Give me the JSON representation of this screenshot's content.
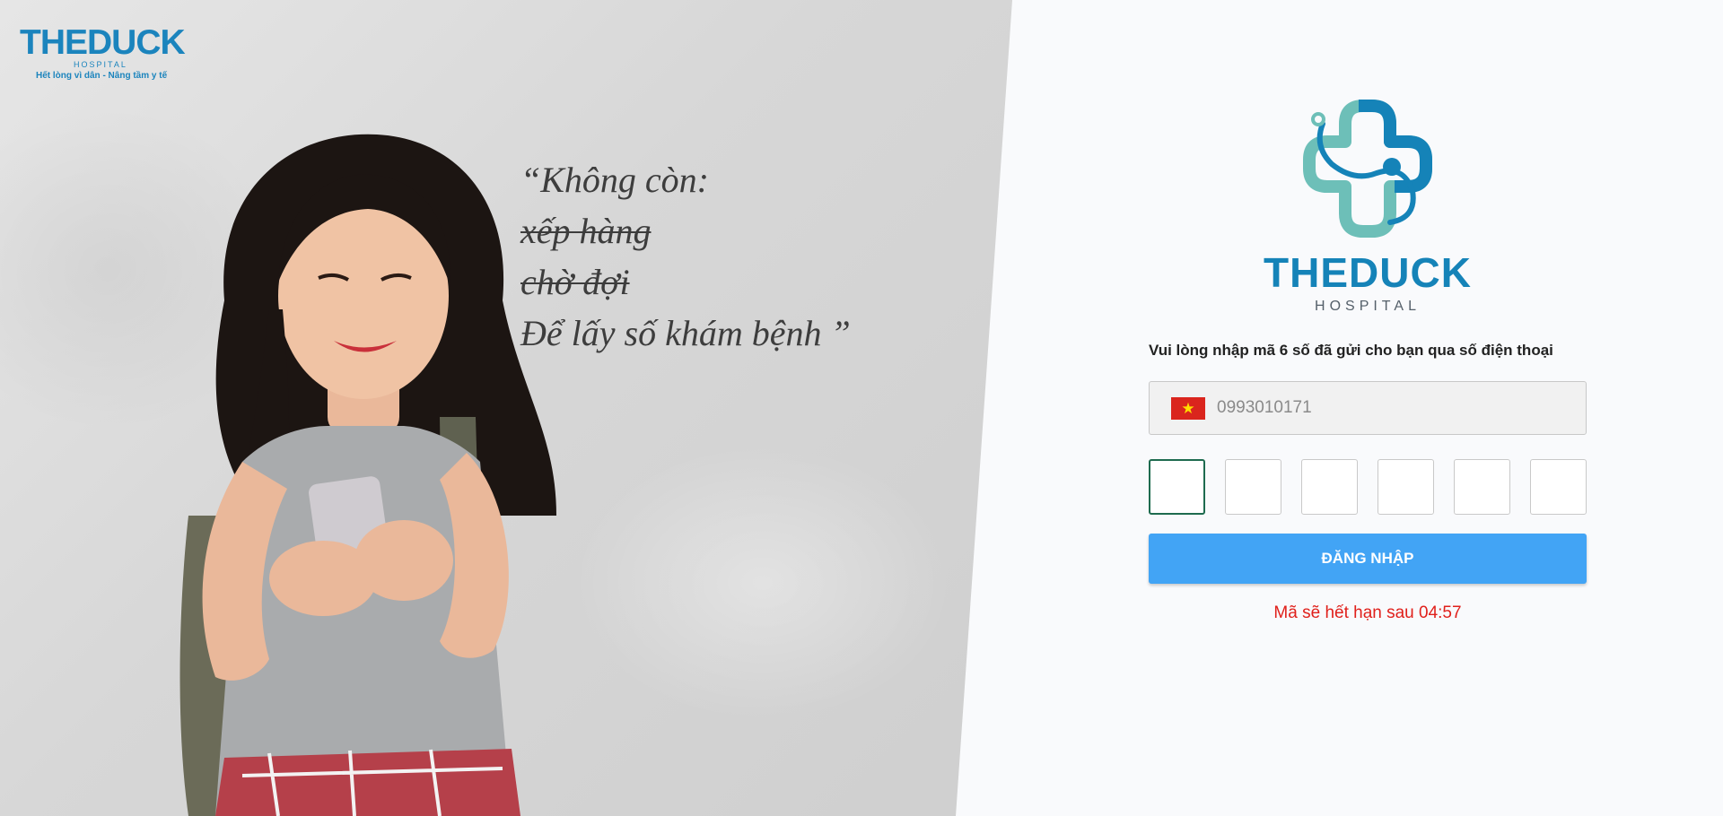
{
  "hero": {
    "brand_name": "THEDUCK",
    "brand_sub": "HOSPITAL",
    "brand_tagline": "Hết lòng vì dân - Nâng tầm y tế",
    "quote_line1": "“Không còn:",
    "quote_struck1": "xếp hàng",
    "quote_struck2": "chờ đợi",
    "quote_line4": "Để lấy số khám bệnh ”"
  },
  "logo": {
    "name": "THEDUCK",
    "sub": "HOSPITAL",
    "icon": "medical-cross-stethoscope-icon"
  },
  "form": {
    "instruction": "Vui lòng nhập mã 6 số đã gửi cho bạn qua số điện thoại",
    "flag_icon": "vietnam-flag-icon",
    "flag_star": "★",
    "phone_value": "0993010171",
    "otp_digits": [
      "",
      "",
      "",
      "",
      "",
      ""
    ],
    "login_label": "ĐĂNG NHẬP",
    "expiry_text": "Mã sẽ hết hạn sau 04:57"
  },
  "colors": {
    "brand_blue": "#1583b8",
    "brand_teal": "#6dbfb8",
    "button_blue": "#42a4f5",
    "expiry_red": "#e0201b"
  }
}
